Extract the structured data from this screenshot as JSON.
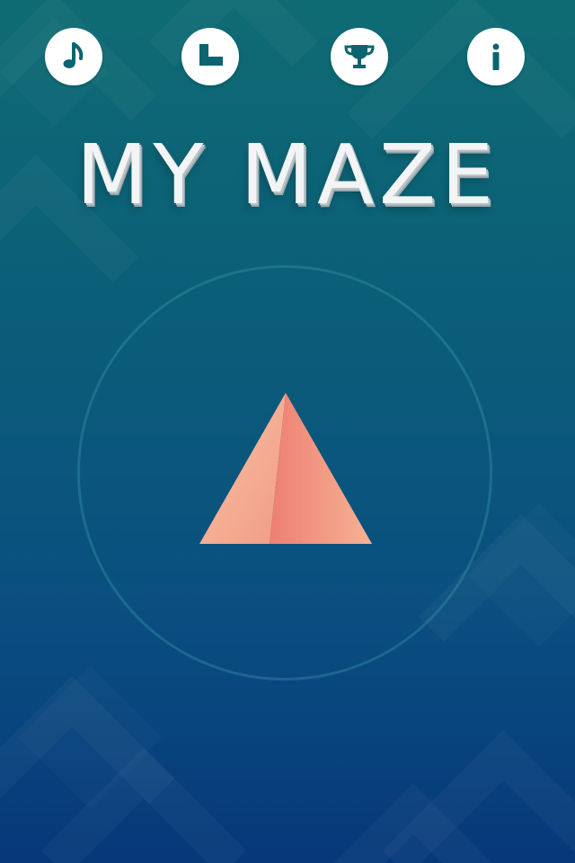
{
  "title": "MY MAZE",
  "toolbar": {
    "music": {
      "icon": "music-note-icon"
    },
    "levels": {
      "icon": "levels-blocks-icon"
    },
    "trophy": {
      "icon": "trophy-icon"
    },
    "info": {
      "icon": "info-icon"
    }
  },
  "play": {
    "icon": "pyramid-play-icon"
  },
  "colors": {
    "background_top": "#0e6b73",
    "background_bottom": "#06387a",
    "button_bg": "#ffffff",
    "icon_color": "#0d6470",
    "pyramid_left": "#f7b597",
    "pyramid_right": "#ee8274"
  }
}
